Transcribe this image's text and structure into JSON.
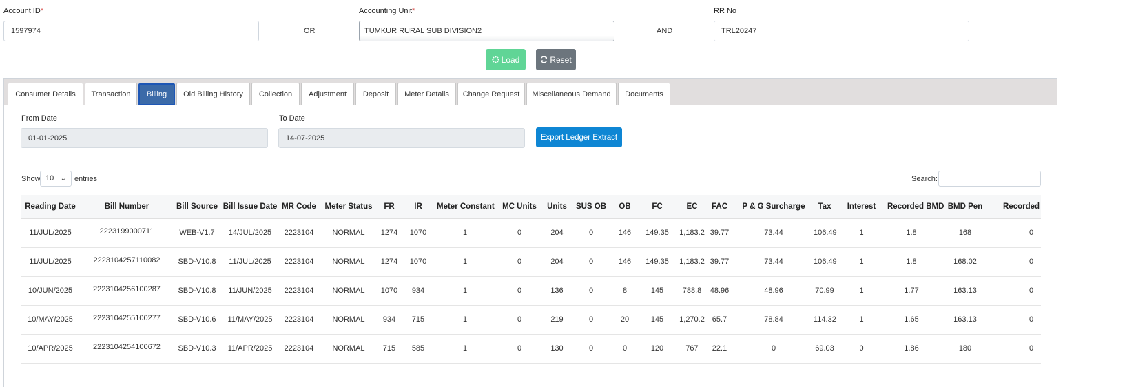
{
  "form": {
    "account_label": "Account ID",
    "account_value": "1597974",
    "or_label": "OR",
    "unit_label": "Accounting Unit",
    "unit_value": "TUMKUR RURAL SUB DIVISION2",
    "and_label": "AND",
    "rr_label": "RR No",
    "rr_value": "TRL20247",
    "required_mark": "*"
  },
  "actions": {
    "load_label": "Load",
    "reset_label": "Reset"
  },
  "tabs": [
    {
      "label": "Consumer Details"
    },
    {
      "label": "Transaction"
    },
    {
      "label": "Billing",
      "active": true
    },
    {
      "label": "Old Billing History"
    },
    {
      "label": "Collection"
    },
    {
      "label": "Adjustment"
    },
    {
      "label": "Deposit"
    },
    {
      "label": "Meter Details"
    },
    {
      "label": "Change Request"
    },
    {
      "label": "Miscellaneous Demand"
    },
    {
      "label": "Documents"
    }
  ],
  "billing": {
    "from_label": "From Date",
    "from_value": "01-01-2025",
    "to_label": "To Date",
    "to_value": "14-07-2025",
    "export_label": "Export Ledger Extract",
    "show_label": "Show",
    "entries_value": "10",
    "entries_label": "entries",
    "search_label": "Search:"
  },
  "table": {
    "columns": [
      "Reading Date",
      "Bill Number",
      "Bill Source",
      "Bill Issue Date",
      "MR Code",
      "Meter Status",
      "FR",
      "IR",
      "Meter Constant",
      "MC Units",
      "Units",
      "SUS OB",
      "OB",
      "FC",
      "EC",
      "FAC",
      "P & G Surcharge",
      "Tax",
      "Interest",
      "Recorded BMD",
      "BMD Pen",
      "Recorded PF"
    ],
    "rows": [
      [
        "11/JUL/2025",
        "2223199000711",
        "WEB-V1.7",
        "14/JUL/2025",
        "2223104",
        "NORMAL",
        "1274",
        "1070",
        "1",
        "0",
        "204",
        "0",
        "146",
        "149.35",
        "1,183.2",
        "39.77",
        "73.44",
        "106.49",
        "1",
        "1.8",
        "168",
        "0"
      ],
      [
        "11/JUL/2025",
        "2223104257110082",
        "SBD-V10.8",
        "11/JUL/2025",
        "2223104",
        "NORMAL",
        "1274",
        "1070",
        "1",
        "0",
        "204",
        "0",
        "146",
        "149.35",
        "1,183.2",
        "39.77",
        "73.44",
        "106.49",
        "1",
        "1.8",
        "168.02",
        "0"
      ],
      [
        "10/JUN/2025",
        "2223104256100287",
        "SBD-V10.8",
        "11/JUN/2025",
        "2223104",
        "NORMAL",
        "1070",
        "934",
        "1",
        "0",
        "136",
        "0",
        "8",
        "145",
        "788.8",
        "48.96",
        "48.96",
        "70.99",
        "1",
        "1.77",
        "163.13",
        "0"
      ],
      [
        "10/MAY/2025",
        "2223104255100277",
        "SBD-V10.6",
        "11/MAY/2025",
        "2223104",
        "NORMAL",
        "934",
        "715",
        "1",
        "0",
        "219",
        "0",
        "20",
        "145",
        "1,270.2",
        "65.7",
        "78.84",
        "114.32",
        "1",
        "1.65",
        "163.13",
        "0"
      ],
      [
        "10/APR/2025",
        "2223104254100672",
        "SBD-V10.3",
        "11/APR/2025",
        "2223104",
        "NORMAL",
        "715",
        "585",
        "1",
        "0",
        "130",
        "0",
        "0",
        "120",
        "767",
        "22.1",
        "0",
        "69.03",
        "0",
        "1.86",
        "180",
        "0"
      ]
    ]
  },
  "colors": {
    "load": "#4fd18b",
    "reset": "#6c757d",
    "export": "#0e86d4",
    "active_tab": "#3b6aa8"
  }
}
